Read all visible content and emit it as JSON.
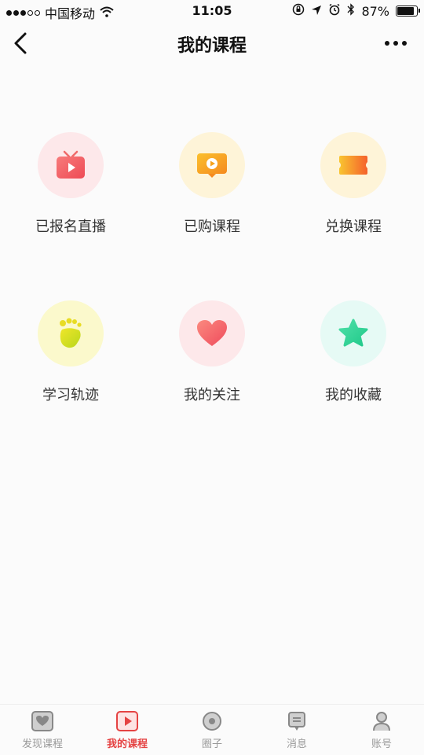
{
  "status_bar": {
    "carrier": "中国移动",
    "time": "11:05",
    "battery": "87%",
    "battery_level": 0.87
  },
  "nav": {
    "title": "我的课程"
  },
  "grid": {
    "items": [
      {
        "label": "已报名直播",
        "icon": "tv-play-icon",
        "bg": "#fde8ea",
        "color": "#f05a5a"
      },
      {
        "label": "已购课程",
        "icon": "video-play-icon",
        "bg": "#fef4d8",
        "color": "#f7a21b"
      },
      {
        "label": "兑换课程",
        "icon": "ticket-icon",
        "bg": "#fef4d8",
        "color": "#f7a21b"
      },
      {
        "label": "学习轨迹",
        "icon": "footprint-icon",
        "bg": "#fbf9cc",
        "color": "#d8d41c"
      },
      {
        "label": "我的关注",
        "icon": "heart-icon",
        "bg": "#fde8ea",
        "color": "#f05a5a"
      },
      {
        "label": "我的收藏",
        "icon": "star-icon",
        "bg": "#e6faf5",
        "color": "#33d496"
      }
    ]
  },
  "tabbar": {
    "tabs": [
      {
        "label": "发现课程",
        "icon": "heart-shield-icon",
        "active": false
      },
      {
        "label": "我的课程",
        "icon": "play-square-icon",
        "active": true
      },
      {
        "label": "圈子",
        "icon": "circle-dot-icon",
        "active": false
      },
      {
        "label": "消息",
        "icon": "message-icon",
        "active": false
      },
      {
        "label": "账号",
        "icon": "person-icon",
        "active": false
      }
    ]
  },
  "colors": {
    "accent": "#e54343",
    "tab_inactive": "#999999"
  }
}
